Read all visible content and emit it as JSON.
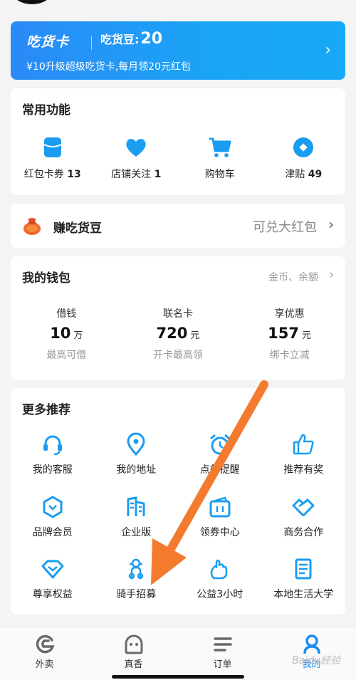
{
  "vip_card": {
    "title": "吃货卡",
    "beans_label": "吃货豆:",
    "beans_value": "20",
    "subtitle": "¥10升级超级吃货卡,每月领20元红包",
    "arrow": "›"
  },
  "common_functions": {
    "title": "常用功能",
    "items": [
      {
        "label": "红包卡券",
        "count": "13",
        "icon": "coupon-icon"
      },
      {
        "label": "店铺关注",
        "count": "1",
        "icon": "heart-icon"
      },
      {
        "label": "购物车",
        "count": "",
        "icon": "cart-icon"
      },
      {
        "label": "津贴",
        "count": "49",
        "icon": "allowance-icon"
      }
    ]
  },
  "earn_beans": {
    "title": "赚吃货豆",
    "right_text": "可兑大红包",
    "arrow": "›",
    "icon": "money-bag-icon"
  },
  "wallet": {
    "title": "我的钱包",
    "more_text": "金币、余额",
    "arrow": "›",
    "items": [
      {
        "name": "借钱",
        "value": "10",
        "unit": "万",
        "sub": "最高可借"
      },
      {
        "name": "联名卡",
        "value": "720",
        "unit": "元",
        "sub": "开卡最高领"
      },
      {
        "name": "享优惠",
        "value": "157",
        "unit": "元",
        "sub": "绑卡立减"
      }
    ]
  },
  "more_recommend": {
    "title": "更多推荐",
    "items": [
      {
        "label": "我的客服",
        "icon": "headset-icon"
      },
      {
        "label": "我的地址",
        "icon": "location-icon"
      },
      {
        "label": "点餐提醒",
        "icon": "alarm-clock-icon"
      },
      {
        "label": "推荐有奖",
        "icon": "thumbs-up-icon"
      },
      {
        "label": "品牌会员",
        "icon": "brand-member-icon"
      },
      {
        "label": "企业版",
        "icon": "building-icon"
      },
      {
        "label": "领券中心",
        "icon": "wallet-ticket-icon"
      },
      {
        "label": "商务合作",
        "icon": "handshake-icon"
      },
      {
        "label": "尊享权益",
        "icon": "diamond-icon"
      },
      {
        "label": "骑手招募",
        "icon": "rider-icon"
      },
      {
        "label": "公益3小时",
        "icon": "hand-icon"
      },
      {
        "label": "本地生活大学",
        "icon": "book-icon"
      }
    ]
  },
  "bottom_nav": [
    {
      "label": "外卖",
      "icon": "takeout-icon"
    },
    {
      "label": "真香",
      "icon": "zhenxiang-icon"
    },
    {
      "label": "订单",
      "icon": "order-list-icon"
    },
    {
      "label": "我的",
      "icon": "profile-icon",
      "active": true
    }
  ],
  "watermark": "Baidu经验",
  "colors": {
    "accent": "#1a8cf0",
    "icon_blue": "#1a9df0",
    "annotation_orange": "#f47a2e"
  }
}
